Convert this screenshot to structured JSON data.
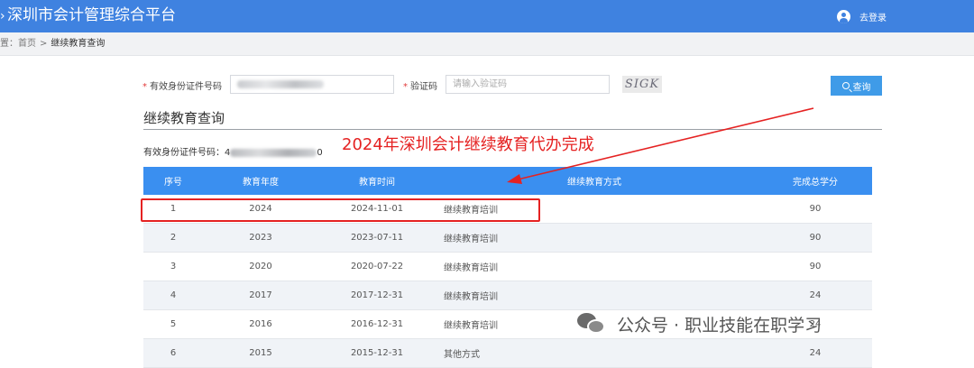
{
  "header": {
    "title": "深圳市会计管理综合平台",
    "logout_label": "去登录"
  },
  "breadcrumb": {
    "prefix": "置：",
    "home": "首页",
    "separator": ">",
    "current": "继续教育查询"
  },
  "form": {
    "id_label": "有效身份证件号码",
    "captcha_label": "验证码",
    "captcha_placeholder": "请输入验证码",
    "captcha_image_text": "SIGK",
    "query_label": "查询"
  },
  "section": {
    "title": "继续教育查询",
    "id_line_label": "有效身份证件号码：",
    "id_prefix": "4",
    "id_suffix": "0"
  },
  "table": {
    "headers": [
      "序号",
      "教育年度",
      "教育时间",
      "继续教育方式",
      "完成总学分"
    ],
    "rows": [
      [
        "1",
        "2024",
        "2024-11-01",
        "继续教育培训",
        "90"
      ],
      [
        "2",
        "2023",
        "2023-07-11",
        "继续教育培训",
        "90"
      ],
      [
        "3",
        "2020",
        "2020-07-22",
        "继续教育培训",
        "90"
      ],
      [
        "4",
        "2017",
        "2017-12-31",
        "继续教育培训",
        "24"
      ],
      [
        "5",
        "2016",
        "2016-12-31",
        "继续教育培训",
        "24"
      ],
      [
        "6",
        "2015",
        "2015-12-31",
        "其他方式",
        "24"
      ]
    ]
  },
  "annotation": {
    "text": "2024年深圳会计继续教育代办完成",
    "color": "#e52222"
  },
  "watermark": {
    "text": "公众号 · 职业技能在职学习"
  },
  "colors": {
    "header_bg": "#3f82e0",
    "table_head_bg": "#3a8ff0",
    "button_bg": "#3f9be8",
    "required_mark": "#e23b3b"
  }
}
